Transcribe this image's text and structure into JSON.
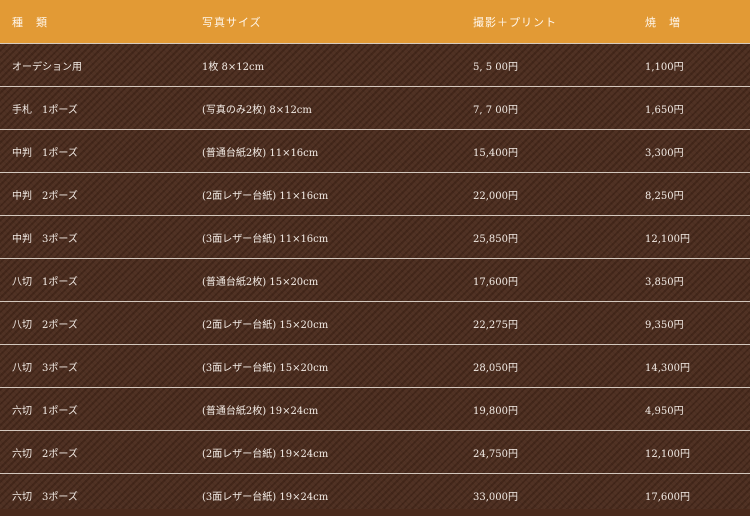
{
  "header": {
    "col1": "種　類",
    "col2": "写真サイズ",
    "col3": "撮影＋プリント",
    "col4": "焼　増"
  },
  "rows": [
    {
      "type": "オーデション用",
      "size": "1枚 8×12cm",
      "print": "5, 5 00円",
      "extra": "1,100円"
    },
    {
      "type": "手札　1ポーズ",
      "size": "(写真のみ2枚) 8×12cm",
      "print": "7, 7 00円",
      "extra": "1,650円"
    },
    {
      "type": "中判　1ポーズ",
      "size": "(普通台紙2枚) 11×16cm",
      "print": "15,400円",
      "extra": "3,300円"
    },
    {
      "type": "中判　2ポーズ",
      "size": "(2面レザー台紙) 11×16cm",
      "print": "22,000円",
      "extra": "8,250円"
    },
    {
      "type": "中判　3ポーズ",
      "size": "(3面レザー台紙) 11×16cm",
      "print": "25,850円",
      "extra": "12,100円"
    },
    {
      "type": "八切　1ポーズ",
      "size": "(普通台紙2枚) 15×20cm",
      "print": "17,600円",
      "extra": "3,850円"
    },
    {
      "type": "八切　2ポーズ",
      "size": "(2面レザー台紙) 15×20cm",
      "print": "22,275円",
      "extra": "9,350円"
    },
    {
      "type": "八切　3ポーズ",
      "size": "(3面レザー台紙) 15×20cm",
      "print": "28,050円",
      "extra": "14,300円"
    },
    {
      "type": "六切　1ポーズ",
      "size": "(普通台紙2枚) 19×24cm",
      "print": "19,800円",
      "extra": "4,950円"
    },
    {
      "type": "六切　2ポーズ",
      "size": "(2面レザー台紙) 19×24cm",
      "print": "24,750円",
      "extra": "12,100円"
    },
    {
      "type": "六切　3ポーズ",
      "size": "(3面レザー台紙) 19×24cm",
      "print": "33,000円",
      "extra": "17,600円"
    }
  ]
}
